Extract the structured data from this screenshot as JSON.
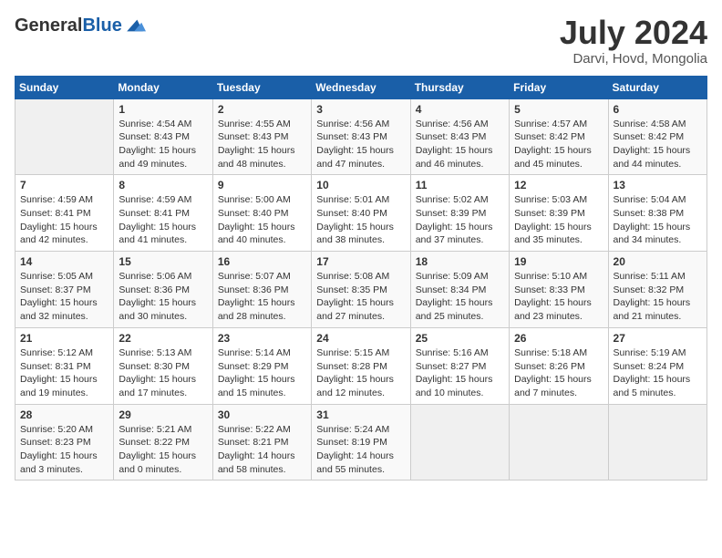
{
  "logo": {
    "general": "General",
    "blue": "Blue"
  },
  "title": {
    "month_year": "July 2024",
    "location": "Darvi, Hovd, Mongolia"
  },
  "days_of_week": [
    "Sunday",
    "Monday",
    "Tuesday",
    "Wednesday",
    "Thursday",
    "Friday",
    "Saturday"
  ],
  "weeks": [
    [
      {
        "day": "",
        "info": ""
      },
      {
        "day": "1",
        "info": "Sunrise: 4:54 AM\nSunset: 8:43 PM\nDaylight: 15 hours\nand 49 minutes."
      },
      {
        "day": "2",
        "info": "Sunrise: 4:55 AM\nSunset: 8:43 PM\nDaylight: 15 hours\nand 48 minutes."
      },
      {
        "day": "3",
        "info": "Sunrise: 4:56 AM\nSunset: 8:43 PM\nDaylight: 15 hours\nand 47 minutes."
      },
      {
        "day": "4",
        "info": "Sunrise: 4:56 AM\nSunset: 8:43 PM\nDaylight: 15 hours\nand 46 minutes."
      },
      {
        "day": "5",
        "info": "Sunrise: 4:57 AM\nSunset: 8:42 PM\nDaylight: 15 hours\nand 45 minutes."
      },
      {
        "day": "6",
        "info": "Sunrise: 4:58 AM\nSunset: 8:42 PM\nDaylight: 15 hours\nand 44 minutes."
      }
    ],
    [
      {
        "day": "7",
        "info": "Sunrise: 4:59 AM\nSunset: 8:41 PM\nDaylight: 15 hours\nand 42 minutes."
      },
      {
        "day": "8",
        "info": "Sunrise: 4:59 AM\nSunset: 8:41 PM\nDaylight: 15 hours\nand 41 minutes."
      },
      {
        "day": "9",
        "info": "Sunrise: 5:00 AM\nSunset: 8:40 PM\nDaylight: 15 hours\nand 40 minutes."
      },
      {
        "day": "10",
        "info": "Sunrise: 5:01 AM\nSunset: 8:40 PM\nDaylight: 15 hours\nand 38 minutes."
      },
      {
        "day": "11",
        "info": "Sunrise: 5:02 AM\nSunset: 8:39 PM\nDaylight: 15 hours\nand 37 minutes."
      },
      {
        "day": "12",
        "info": "Sunrise: 5:03 AM\nSunset: 8:39 PM\nDaylight: 15 hours\nand 35 minutes."
      },
      {
        "day": "13",
        "info": "Sunrise: 5:04 AM\nSunset: 8:38 PM\nDaylight: 15 hours\nand 34 minutes."
      }
    ],
    [
      {
        "day": "14",
        "info": "Sunrise: 5:05 AM\nSunset: 8:37 PM\nDaylight: 15 hours\nand 32 minutes."
      },
      {
        "day": "15",
        "info": "Sunrise: 5:06 AM\nSunset: 8:36 PM\nDaylight: 15 hours\nand 30 minutes."
      },
      {
        "day": "16",
        "info": "Sunrise: 5:07 AM\nSunset: 8:36 PM\nDaylight: 15 hours\nand 28 minutes."
      },
      {
        "day": "17",
        "info": "Sunrise: 5:08 AM\nSunset: 8:35 PM\nDaylight: 15 hours\nand 27 minutes."
      },
      {
        "day": "18",
        "info": "Sunrise: 5:09 AM\nSunset: 8:34 PM\nDaylight: 15 hours\nand 25 minutes."
      },
      {
        "day": "19",
        "info": "Sunrise: 5:10 AM\nSunset: 8:33 PM\nDaylight: 15 hours\nand 23 minutes."
      },
      {
        "day": "20",
        "info": "Sunrise: 5:11 AM\nSunset: 8:32 PM\nDaylight: 15 hours\nand 21 minutes."
      }
    ],
    [
      {
        "day": "21",
        "info": "Sunrise: 5:12 AM\nSunset: 8:31 PM\nDaylight: 15 hours\nand 19 minutes."
      },
      {
        "day": "22",
        "info": "Sunrise: 5:13 AM\nSunset: 8:30 PM\nDaylight: 15 hours\nand 17 minutes."
      },
      {
        "day": "23",
        "info": "Sunrise: 5:14 AM\nSunset: 8:29 PM\nDaylight: 15 hours\nand 15 minutes."
      },
      {
        "day": "24",
        "info": "Sunrise: 5:15 AM\nSunset: 8:28 PM\nDaylight: 15 hours\nand 12 minutes."
      },
      {
        "day": "25",
        "info": "Sunrise: 5:16 AM\nSunset: 8:27 PM\nDaylight: 15 hours\nand 10 minutes."
      },
      {
        "day": "26",
        "info": "Sunrise: 5:18 AM\nSunset: 8:26 PM\nDaylight: 15 hours\nand 7 minutes."
      },
      {
        "day": "27",
        "info": "Sunrise: 5:19 AM\nSunset: 8:24 PM\nDaylight: 15 hours\nand 5 minutes."
      }
    ],
    [
      {
        "day": "28",
        "info": "Sunrise: 5:20 AM\nSunset: 8:23 PM\nDaylight: 15 hours\nand 3 minutes."
      },
      {
        "day": "29",
        "info": "Sunrise: 5:21 AM\nSunset: 8:22 PM\nDaylight: 15 hours\nand 0 minutes."
      },
      {
        "day": "30",
        "info": "Sunrise: 5:22 AM\nSunset: 8:21 PM\nDaylight: 14 hours\nand 58 minutes."
      },
      {
        "day": "31",
        "info": "Sunrise: 5:24 AM\nSunset: 8:19 PM\nDaylight: 14 hours\nand 55 minutes."
      },
      {
        "day": "",
        "info": ""
      },
      {
        "day": "",
        "info": ""
      },
      {
        "day": "",
        "info": ""
      }
    ]
  ]
}
